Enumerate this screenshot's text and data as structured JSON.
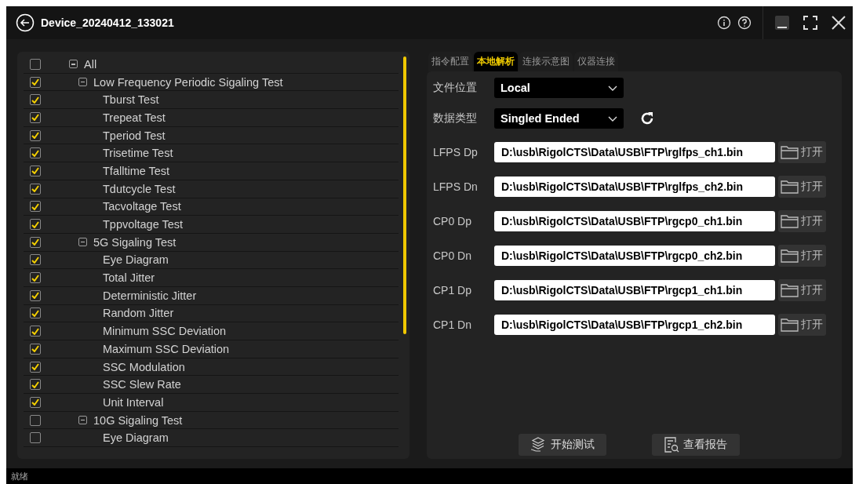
{
  "window": {
    "title": "Device_20240412_133021"
  },
  "tree": {
    "label": "All",
    "checked": false,
    "expanded": true,
    "children": [
      {
        "label": "Low Frequency Periodic Sigaling Test",
        "checked": true,
        "expanded": true,
        "children": [
          {
            "label": "Tburst Test",
            "checked": true
          },
          {
            "label": "Trepeat Test",
            "checked": true
          },
          {
            "label": "Tperiod Test",
            "checked": true
          },
          {
            "label": "Trisetime Test",
            "checked": true
          },
          {
            "label": "Tfalltime Test",
            "checked": true
          },
          {
            "label": "Tdutcycle Test",
            "checked": true
          },
          {
            "label": "Tacvoltage Test",
            "checked": true
          },
          {
            "label": "Tppvoltage Test",
            "checked": true
          }
        ]
      },
      {
        "label": "5G Sigaling Test",
        "checked": true,
        "expanded": true,
        "children": [
          {
            "label": "Eye Diagram",
            "checked": true
          },
          {
            "label": "Total Jitter",
            "checked": true
          },
          {
            "label": "Deterministic Jitter",
            "checked": true
          },
          {
            "label": "Random Jitter",
            "checked": true
          },
          {
            "label": "Minimum SSC Deviation",
            "checked": true
          },
          {
            "label": "Maximum SSC Deviation",
            "checked": true
          },
          {
            "label": "SSC Modulation",
            "checked": true
          },
          {
            "label": "SSC Slew Rate",
            "checked": true
          },
          {
            "label": "Unit Interval",
            "checked": true
          }
        ]
      },
      {
        "label": "10G Sigaling Test",
        "checked": false,
        "expanded": true,
        "children": [
          {
            "label": "Eye Diagram",
            "checked": false
          }
        ]
      }
    ]
  },
  "tabs": [
    {
      "label": "指令配置",
      "selected": false
    },
    {
      "label": "本地解析",
      "selected": true
    },
    {
      "label": "连接示意图",
      "selected": false
    },
    {
      "label": "仪器连接",
      "selected": false
    }
  ],
  "selects": [
    {
      "label": "文件位置",
      "value": "Local",
      "refresh": false
    },
    {
      "label": "数据类型",
      "value": "Singled Ended",
      "refresh": true
    }
  ],
  "files": [
    {
      "label": "LFPS Dp",
      "value": "D:\\usb\\RigolCTS\\Data\\USB\\FTP\\rglfps_ch1.bin",
      "button": "打开"
    },
    {
      "label": "LFPS Dn",
      "value": "D:\\usb\\RigolCTS\\Data\\USB\\FTP\\rglfps_ch2.bin",
      "button": "打开"
    },
    {
      "label": "CP0 Dp",
      "value": "D:\\usb\\RigolCTS\\Data\\USB\\FTP\\rgcp0_ch1.bin",
      "button": "打开"
    },
    {
      "label": "CP0 Dn",
      "value": "D:\\usb\\RigolCTS\\Data\\USB\\FTP\\rgcp0_ch2.bin",
      "button": "打开"
    },
    {
      "label": "CP1 Dp",
      "value": "D:\\usb\\RigolCTS\\Data\\USB\\FTP\\rgcp1_ch1.bin",
      "button": "打开"
    },
    {
      "label": "CP1 Dn",
      "value": "D:\\usb\\RigolCTS\\Data\\USB\\FTP\\rgcp1_ch2.bin",
      "button": "打开"
    }
  ],
  "actions": [
    {
      "label": "开始测试",
      "kind": "start"
    },
    {
      "label": "查看报告",
      "kind": "report"
    }
  ],
  "status_bar": "就绪"
}
